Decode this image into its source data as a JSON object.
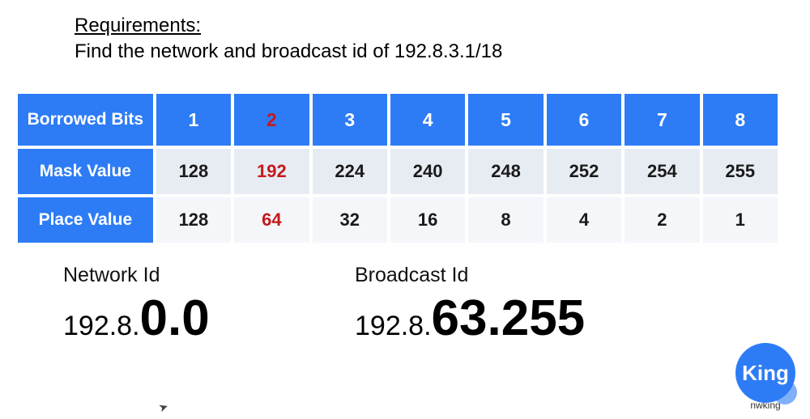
{
  "requirements": {
    "title": "Requirements:",
    "body": "Find the network and broadcast id of 192.8.3.1/18"
  },
  "table": {
    "row_labels": [
      "Borrowed Bits",
      "Mask Value",
      "Place Value"
    ],
    "highlight_col_index": 1,
    "cols": [
      "1",
      "2",
      "3",
      "4",
      "5",
      "6",
      "7",
      "8"
    ],
    "mask": [
      "128",
      "192",
      "224",
      "240",
      "248",
      "252",
      "254",
      "255"
    ],
    "place": [
      "128",
      "64",
      "32",
      "16",
      "8",
      "4",
      "2",
      "1"
    ]
  },
  "results": {
    "network_label": "Network Id",
    "network_prefix": "192.8.",
    "network_big": "0.0",
    "broadcast_label": "Broadcast Id",
    "broadcast_prefix": "192.8.",
    "broadcast_big": "63.255"
  },
  "brand": {
    "name": "King",
    "sub": "nwking"
  }
}
